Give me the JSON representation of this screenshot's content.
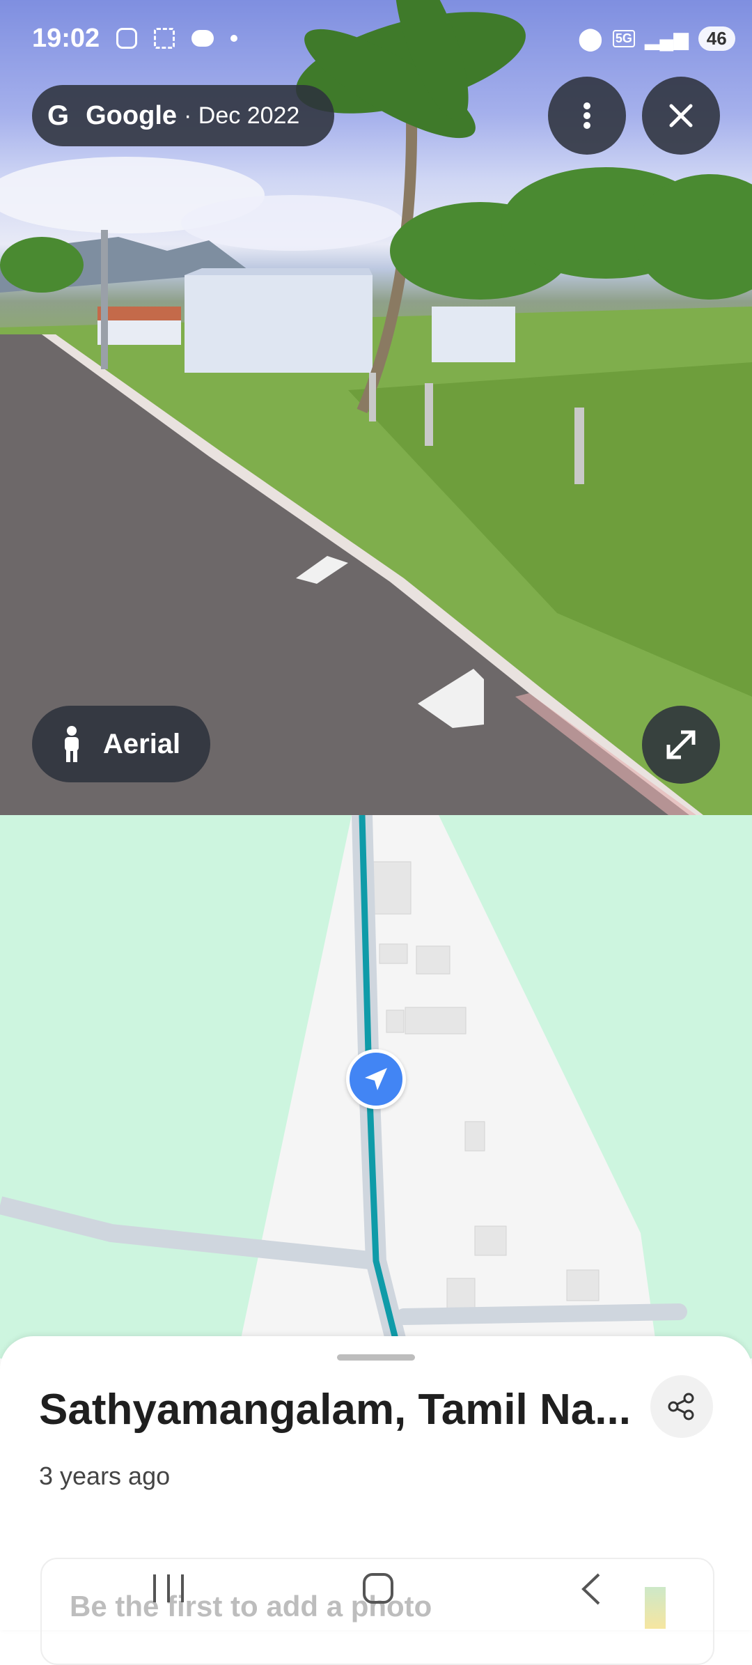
{
  "status_bar": {
    "time": "19:02",
    "network": "5G",
    "battery": "46",
    "icons": [
      "instagram-icon",
      "screenshot-icon",
      "chat-bubble-icon",
      "dot-icon",
      "location-icon",
      "signal-icon",
      "battery-icon"
    ]
  },
  "header": {
    "brand_letter": "G",
    "brand": "Google",
    "date": "· Dec 2022",
    "menu_icon": "more-vertical-icon",
    "close_icon": "close-icon"
  },
  "controls": {
    "aerial_label": "Aerial",
    "aerial_icon": "person-icon",
    "expand_icon": "expand-icon"
  },
  "place": {
    "title": "Sathyamangalam, Tamil Na...",
    "subtitle": "3 years ago",
    "share_icon": "share-icon",
    "photo_prompt": "Be the first to add a photo"
  },
  "colors": {
    "map_green": "#cdf5df",
    "route_teal": "#0f9ba8",
    "location_blue": "#4285f4"
  }
}
